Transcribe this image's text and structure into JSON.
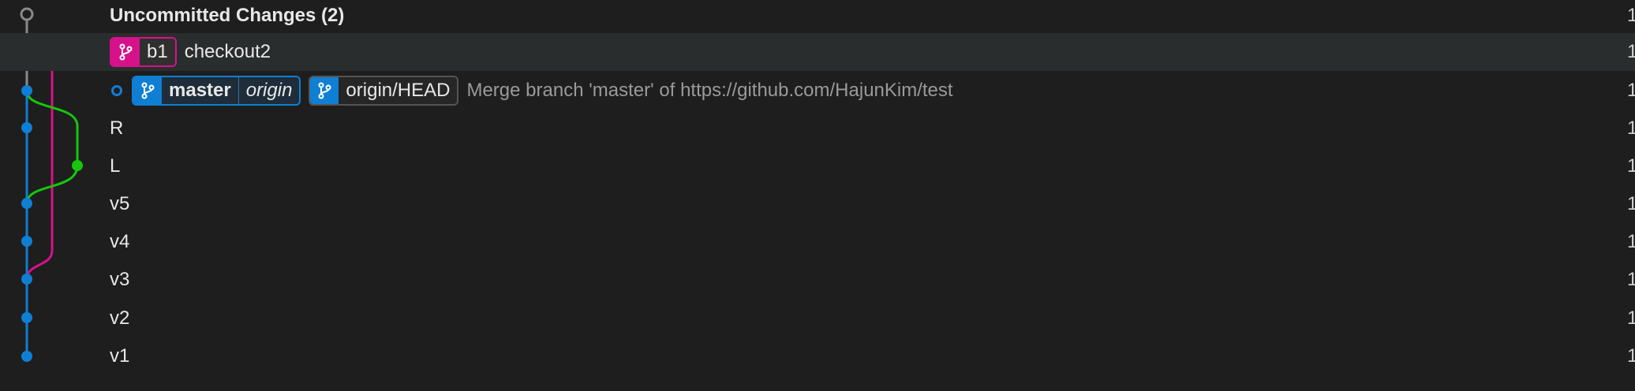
{
  "colors": {
    "background": "#1e1e1e",
    "selected_row": "#2a2d2e",
    "blue_lane": "#0f7fd4",
    "pink_lane": "#d6128a",
    "green_lane": "#16c60c",
    "gray_lane": "#8a8a8a"
  },
  "rows": [
    {
      "message": "Uncommitted Changes (2)",
      "trailing": "1"
    },
    {
      "branch": "b1",
      "message": "checkout2",
      "trailing": "1"
    },
    {
      "branch": "master",
      "remote": "origin",
      "ref": "origin/HEAD",
      "message": "Merge branch 'master' of https://github.com/HajunKim/test",
      "trailing": "1"
    },
    {
      "message": "R",
      "trailing": "1"
    },
    {
      "message": "L",
      "trailing": "1"
    },
    {
      "message": "v5",
      "trailing": "1"
    },
    {
      "message": "v4",
      "trailing": "1"
    },
    {
      "message": "v3",
      "trailing": "1"
    },
    {
      "message": "v2",
      "trailing": "1"
    },
    {
      "message": "v1",
      "trailing": "1"
    }
  ],
  "icons": {
    "branch": "git-branch-icon",
    "head": "head-indicator-icon"
  }
}
